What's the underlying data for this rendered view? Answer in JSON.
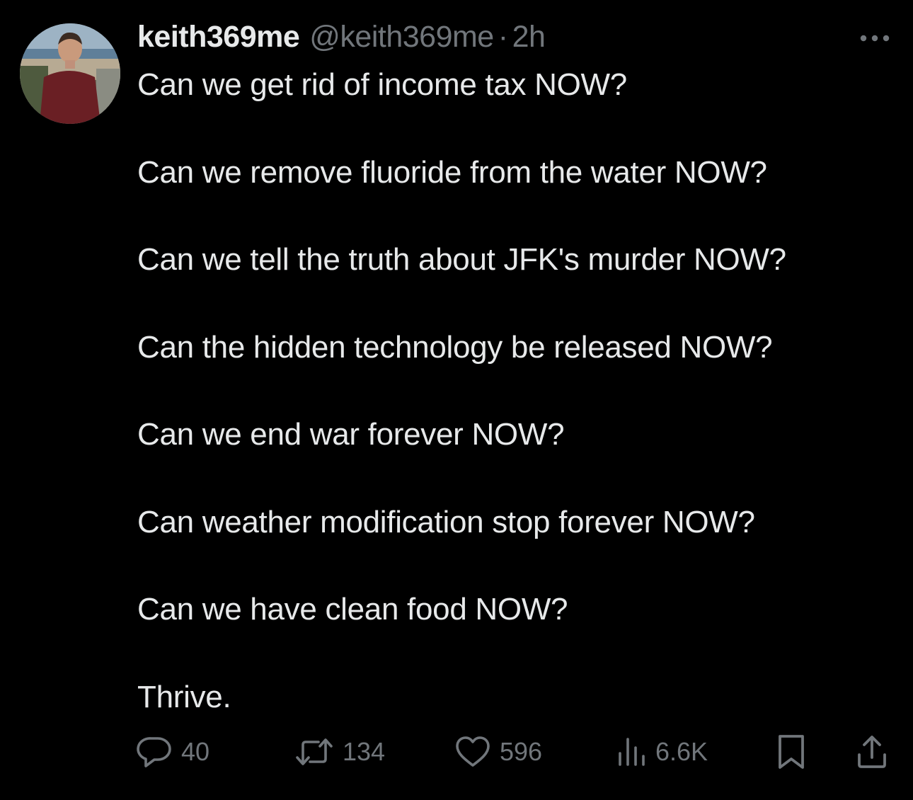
{
  "tweet": {
    "author": {
      "display_name": "keith369me",
      "handle": "@keith369me",
      "separator": "·",
      "time": "2h",
      "avatar_icon": "profile-photo"
    },
    "lines": [
      "Can we get rid of income tax NOW?",
      "Can we remove fluoride from the water NOW?",
      "Can we tell the truth about JFK's murder NOW?",
      "Can the hidden technology be released NOW?",
      "Can we end war forever NOW?",
      "Can weather modification stop forever NOW?",
      "Can we have clean food NOW?",
      "Thrive."
    ],
    "actions": {
      "reply": {
        "icon": "reply-icon",
        "count": "40"
      },
      "repost": {
        "icon": "repost-icon",
        "count": "134"
      },
      "like": {
        "icon": "heart-icon",
        "count": "596"
      },
      "views": {
        "icon": "views-icon",
        "count": "6.6K"
      },
      "bookmark": {
        "icon": "bookmark-icon"
      },
      "share": {
        "icon": "share-icon"
      }
    }
  },
  "colors": {
    "background": "#000000",
    "text_primary": "#e7e9ea",
    "text_secondary": "#71767b"
  }
}
